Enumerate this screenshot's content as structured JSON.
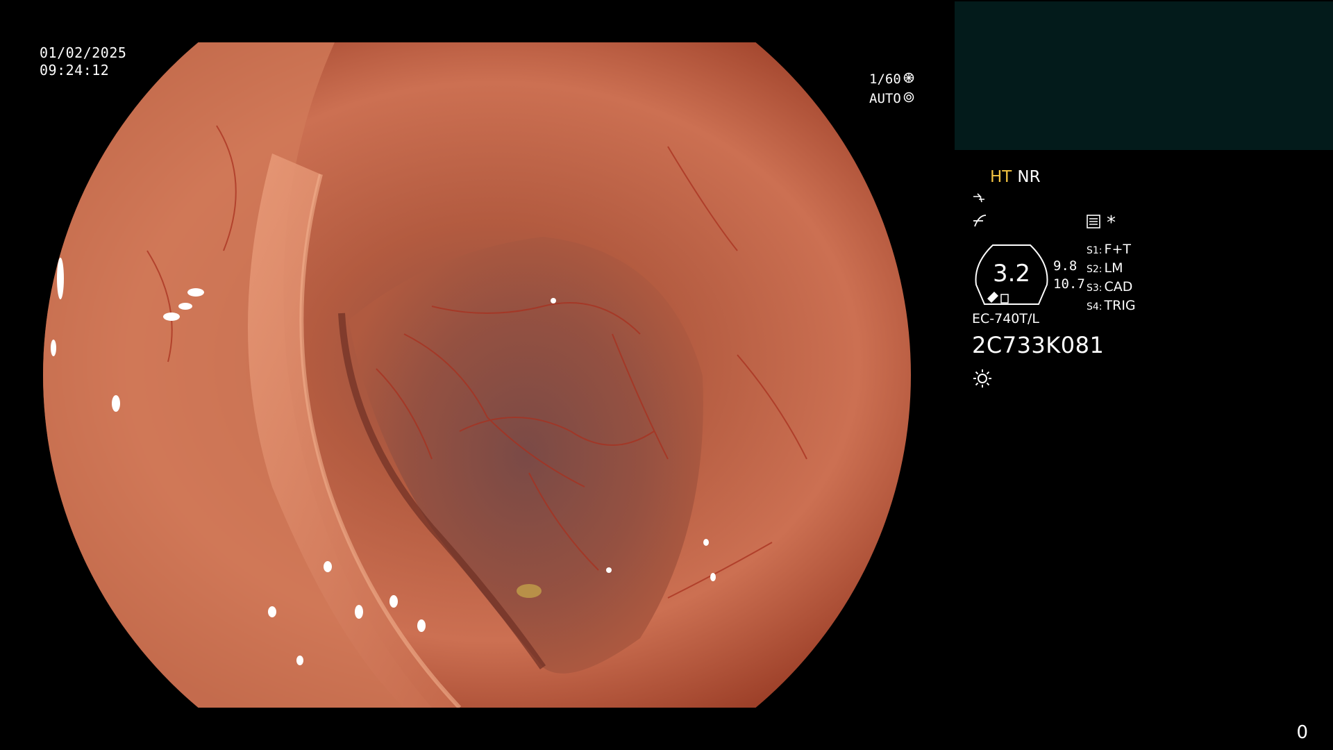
{
  "overlay": {
    "date": "01/02/2025",
    "time": "09:24:12",
    "shutter": "1/60",
    "exposure_mode": "AUTO"
  },
  "info": {
    "ht_label": "HT",
    "nr_label": "NR",
    "zoom_value": "3.2",
    "zoom_secondary_1": "9.8",
    "zoom_secondary_2": "10.7",
    "switches": [
      {
        "key": "S1:",
        "value": "F+T"
      },
      {
        "key": "S2:",
        "value": "LM"
      },
      {
        "key": "S3:",
        "value": "CAD"
      },
      {
        "key": "S4:",
        "value": "TRIG"
      }
    ],
    "asterisk": "*",
    "model": "EC-740T/L",
    "serial": "2C733K081"
  },
  "counter": "0",
  "icons": {
    "shutter": "aperture-icon",
    "auto": "iris-icon",
    "edge": "edge-enhance-icon",
    "gamma": "gamma-icon",
    "menu": "menu-icon",
    "light": "light-icon"
  },
  "colors": {
    "background": "#000000",
    "thumb_panel": "#031b1b",
    "ht_label": "#f5c542",
    "tissue_base": "#c9694a"
  }
}
